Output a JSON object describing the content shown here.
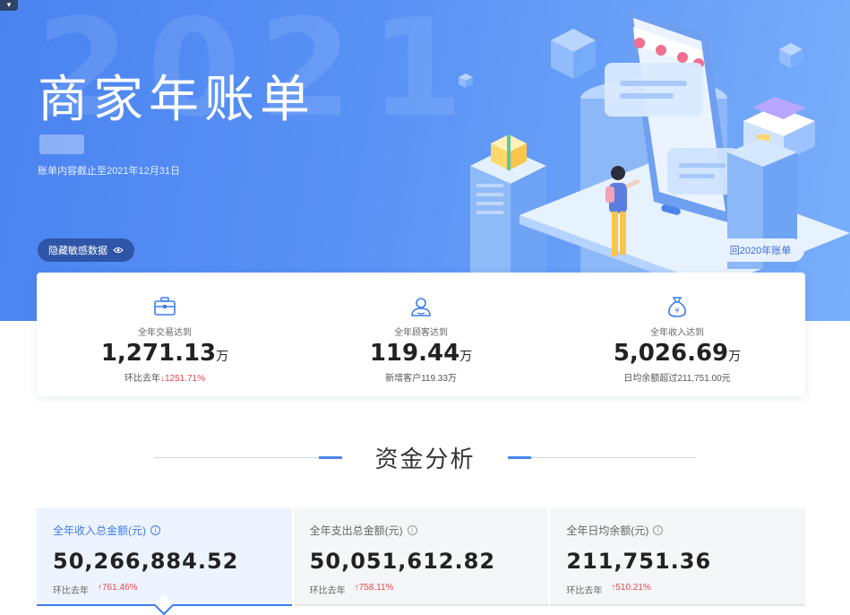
{
  "banner": {
    "year_watermark": "2021",
    "title": "商家年账单",
    "cutoff_text": "账单内容截止至2021年12月31日",
    "hide_button_label": "隐藏敏感数据",
    "prev_bill_label": "回2020年账单"
  },
  "summary": [
    {
      "icon": "briefcase-icon",
      "label": "全年交易达到",
      "value": "1,271.13",
      "unit": "万",
      "sub_prefix": "环比去年",
      "sub_trend": "↓",
      "sub_value": "1251.71%"
    },
    {
      "icon": "users-icon",
      "label": "全年顾客达到",
      "value": "119.44",
      "unit": "万",
      "sub_prefix": "新增客户",
      "sub_value": "119.33万"
    },
    {
      "icon": "money-bag-icon",
      "label": "全年收入达到",
      "value": "5,026.69",
      "unit": "万",
      "sub_prefix": "日均余额超过",
      "sub_value": "211,751.00元"
    }
  ],
  "section": {
    "title": "资金分析"
  },
  "tabs": [
    {
      "label": "全年收入总金额(元)",
      "value": "50,266,884.52",
      "compare_label": "环比去年",
      "compare_value": "↑761.46%",
      "active": true
    },
    {
      "label": "全年支出总金额(元)",
      "value": "50,051,612.82",
      "compare_label": "环比去年",
      "compare_value": "↑758.11%",
      "active": false
    },
    {
      "label": "全年日均余额(元)",
      "value": "211,751.36",
      "compare_label": "环比去年",
      "compare_value": "↑510.21%",
      "active": false
    }
  ],
  "colors": {
    "accent": "#3d7cf0",
    "banner": "#4b83f0",
    "down": "#e5484d",
    "up": "#e5484d"
  }
}
